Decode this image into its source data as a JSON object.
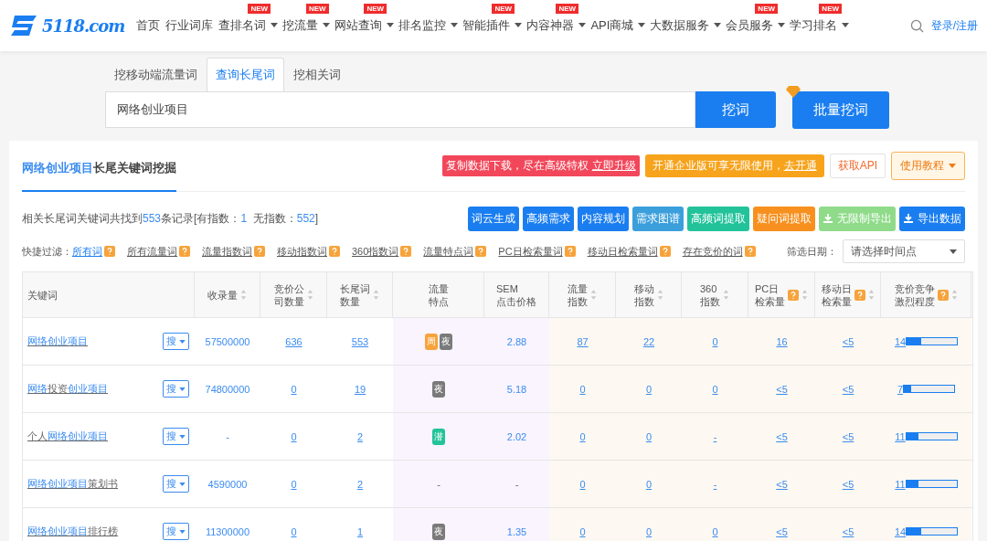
{
  "nav": {
    "logo": "5118.com",
    "login": "登录/注册",
    "items": [
      {
        "label": "首页",
        "dropdown": false
      },
      {
        "label": "行业词库",
        "dropdown": false
      },
      {
        "label": "查排名词",
        "dropdown": true,
        "badge": "NEW"
      },
      {
        "label": "挖流量",
        "dropdown": true,
        "badge": "NEW"
      },
      {
        "label": "网站查询",
        "dropdown": true,
        "badge": "NEW"
      },
      {
        "label": "排名监控",
        "dropdown": true
      },
      {
        "label": "智能插件",
        "dropdown": true,
        "badge": "NEW"
      },
      {
        "label": "内容神器",
        "dropdown": true,
        "badge": "NEW"
      },
      {
        "label": "API商城",
        "dropdown": true
      },
      {
        "label": "大数据服务",
        "dropdown": true
      },
      {
        "label": "会员服务",
        "dropdown": true,
        "badge": "NEW"
      },
      {
        "label": "学习排名",
        "dropdown": true,
        "badge": "NEW"
      }
    ]
  },
  "search": {
    "tabs": [
      {
        "label": "挖移动端流量词",
        "selected": false
      },
      {
        "label": "查询长尾词",
        "selected": true
      },
      {
        "label": "挖相关词",
        "selected": false
      }
    ],
    "value": "网络创业项目",
    "button": "挖词",
    "batch_button": "批量挖词"
  },
  "card": {
    "title_keyword": "网络创业项目",
    "title_rest": "长尾关键词挖掘",
    "promo_text": "复制数据下载，尽在高级特权 ",
    "promo_link": "立即升级",
    "enterprise_text": "开通企业版可享无限使用，",
    "enterprise_link": "去开通",
    "api_button": "获取API",
    "tutorial_button": "使用教程"
  },
  "summary": [
    {
      "text": "相关长尾词关键词共找到",
      "highlight": false
    },
    {
      "text": "553",
      "highlight": true
    },
    {
      "text": "条记录[有指数：",
      "highlight": false
    },
    {
      "text": "1",
      "highlight": true
    },
    {
      "text": "  无指数：",
      "highlight": false
    },
    {
      "text": "552",
      "highlight": true
    },
    {
      "text": "]",
      "highlight": false
    }
  ],
  "toolbar": [
    {
      "label": "词云生成",
      "color": "#1a7ef0",
      "kind": "action"
    },
    {
      "label": "高频需求",
      "color": "#1a7ef0",
      "kind": "action"
    },
    {
      "label": "内容规划",
      "color": "#1a7ef0",
      "kind": "action"
    },
    {
      "label": "需求图谱",
      "color": "#3b9fdc",
      "kind": "action"
    },
    {
      "label": "高频词提取",
      "color": "#22c39a",
      "kind": "action"
    },
    {
      "label": "疑问词提取",
      "color": "#f7901e",
      "kind": "action"
    },
    {
      "label": "无限制导出",
      "color": "#8fdb8a",
      "kind": "export"
    },
    {
      "label": "导出数据",
      "color": "#1a7ef0",
      "kind": "export"
    }
  ],
  "filters": {
    "label": "快捷过滤：",
    "items": [
      {
        "label": "所有词",
        "selected": true
      },
      {
        "label": "所有流量词",
        "selected": false
      },
      {
        "label": "流量指数词",
        "selected": false
      },
      {
        "label": "移动指数词",
        "selected": false
      },
      {
        "label": "360指数词",
        "selected": false
      },
      {
        "label": "流量特点词",
        "selected": false
      },
      {
        "label": "PC日检索量词",
        "selected": false
      },
      {
        "label": "移动日检索量词",
        "selected": false
      },
      {
        "label": "存在竞价的词",
        "selected": false
      }
    ],
    "date_label": "筛选日期：",
    "date_placeholder": "请选择时间点"
  },
  "table": {
    "columns": [
      {
        "label": "关键词",
        "sortable": false,
        "help": false
      },
      {
        "label": "收录量",
        "sortable": true,
        "help": false
      },
      {
        "label": "竞价公司数量",
        "sortable": true,
        "help": false
      },
      {
        "label": "长尾词数量",
        "sortable": true,
        "help": false
      },
      {
        "label": "流量特点",
        "sortable": false,
        "help": false
      },
      {
        "label": "SEM\n点击价格",
        "sortable": false,
        "help": false
      },
      {
        "label": "流量指数",
        "sortable": true,
        "help": false
      },
      {
        "label": "移动指数",
        "sortable": true,
        "help": false
      },
      {
        "label": "360\n指数",
        "sortable": true,
        "help": false
      },
      {
        "label": "PC日检索量",
        "sortable": true,
        "help": true
      },
      {
        "label": "移动日检索量",
        "sortable": true,
        "help": true
      },
      {
        "label": "竞价竞争激烈程度",
        "sortable": true,
        "help": true
      }
    ],
    "rows": [
      {
        "keyword": [
          {
            "text": "网络创业项目",
            "match": true
          }
        ],
        "search_button": "搜",
        "indexed": "57500000",
        "bid_companies": "636",
        "long_tail": "553",
        "traffic_tags": [
          {
            "label": "周",
            "kind": "week"
          },
          {
            "label": "夜",
            "kind": "night"
          }
        ],
        "sem": "2.88",
        "traffic_index": "87",
        "mobile_index": "22",
        "index_360": "0",
        "pc_daily": "16",
        "mobile_daily": "<5",
        "competition": "14",
        "level": 0.28
      },
      {
        "keyword": [
          {
            "text": "网络",
            "match": true
          },
          {
            "text": "投资",
            "match": false
          },
          {
            "text": "创业项目",
            "match": true
          }
        ],
        "search_button": "搜",
        "indexed": "74800000",
        "bid_companies": "0",
        "long_tail": "19",
        "traffic_tags": [
          {
            "label": "夜",
            "kind": "night"
          }
        ],
        "sem": "5.18",
        "traffic_index": "0",
        "mobile_index": "0",
        "index_360": "0",
        "pc_daily": "<5",
        "mobile_daily": "<5",
        "competition": "7",
        "level": 0.15
      },
      {
        "keyword": [
          {
            "text": "个人",
            "match": false
          },
          {
            "text": "网络创业项目",
            "match": true
          }
        ],
        "search_button": "搜",
        "indexed": "-",
        "bid_companies": "0",
        "long_tail": "2",
        "traffic_tags": [
          {
            "label": "潜",
            "kind": "potential"
          }
        ],
        "sem": "2.02",
        "traffic_index": "0",
        "mobile_index": "0",
        "index_360": "-",
        "pc_daily": "<5",
        "mobile_daily": "<5",
        "competition": "11",
        "level": 0.24
      },
      {
        "keyword": [
          {
            "text": "网络创业项目",
            "match": true
          },
          {
            "text": "策划书",
            "match": false
          }
        ],
        "search_button": "搜",
        "indexed": "4590000",
        "bid_companies": "0",
        "long_tail": "2",
        "traffic_text": "-",
        "sem": "-",
        "traffic_index": "0",
        "mobile_index": "0",
        "index_360": "-",
        "pc_daily": "<5",
        "mobile_daily": "<5",
        "competition": "11",
        "level": 0.24
      },
      {
        "keyword": [
          {
            "text": "网络创业项目",
            "match": true
          },
          {
            "text": "排行榜",
            "match": false
          }
        ],
        "search_button": "搜",
        "indexed": "11300000",
        "bid_companies": "0",
        "long_tail": "1",
        "traffic_tags": [
          {
            "label": "夜",
            "kind": "night"
          }
        ],
        "sem": "1.35",
        "traffic_index": "0",
        "mobile_index": "0",
        "index_360": "0",
        "pc_daily": "<5",
        "mobile_daily": "<5",
        "competition": "14",
        "level": 0.28
      }
    ]
  }
}
